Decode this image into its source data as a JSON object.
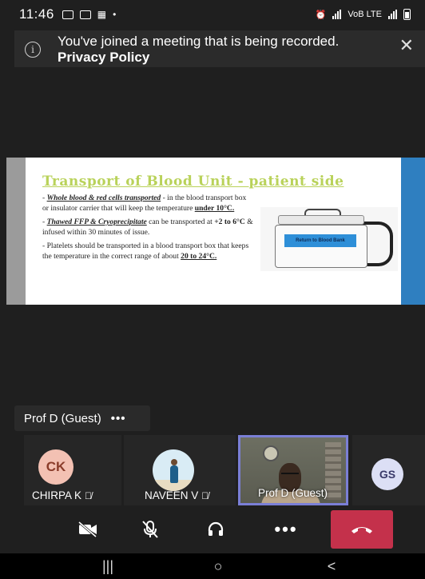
{
  "status_bar": {
    "time": "11:46",
    "network_text": "VoB LTE"
  },
  "banner": {
    "message": "You've joined a meeting that is being recorded.",
    "link": "Privacy Policy",
    "info_icon": "i",
    "close_icon": "✕"
  },
  "slide": {
    "title": "Transport of Blood Unit - patient side",
    "bullet1_emph": "Whole blood & red cells transported",
    "bullet1_rest": " - in the blood transport box or insulator carrier that will keep the temperature ",
    "bullet1_val": "under 10°C.",
    "bullet2_emph": "Thawed FFP & Cryoprecipitate",
    "bullet2_mid": " can be transported at ",
    "bullet2_val": "+2 to 6°C",
    "bullet2_rest": " & infused within 30 minutes of issue.",
    "bullet3_text": "Platelets should be transported in a blood transport box that keeps the temperature in the correct range of about ",
    "bullet3_val": "20 to 24°C.",
    "image_label": "Return to Blood Bank"
  },
  "presenter_chip": {
    "name": "Prof D (Guest)",
    "more": "•••"
  },
  "participants": [
    {
      "initials": "CK",
      "name": "CHIRPA K"
    },
    {
      "initials": "",
      "name": "NAVEEN V"
    },
    {
      "initials": "",
      "name": "Prof D (Guest)"
    },
    {
      "initials": "GS",
      "name": ""
    }
  ],
  "controls": {
    "more_label": "•••"
  },
  "nav": {
    "recents": "|||",
    "home": "○",
    "back": "<"
  },
  "colors": {
    "end_call": "#c4314b",
    "active_speaker_border": "#7a7fd6",
    "slide_title": "#b9d25a",
    "slide_accent": "#2f7fc0"
  }
}
